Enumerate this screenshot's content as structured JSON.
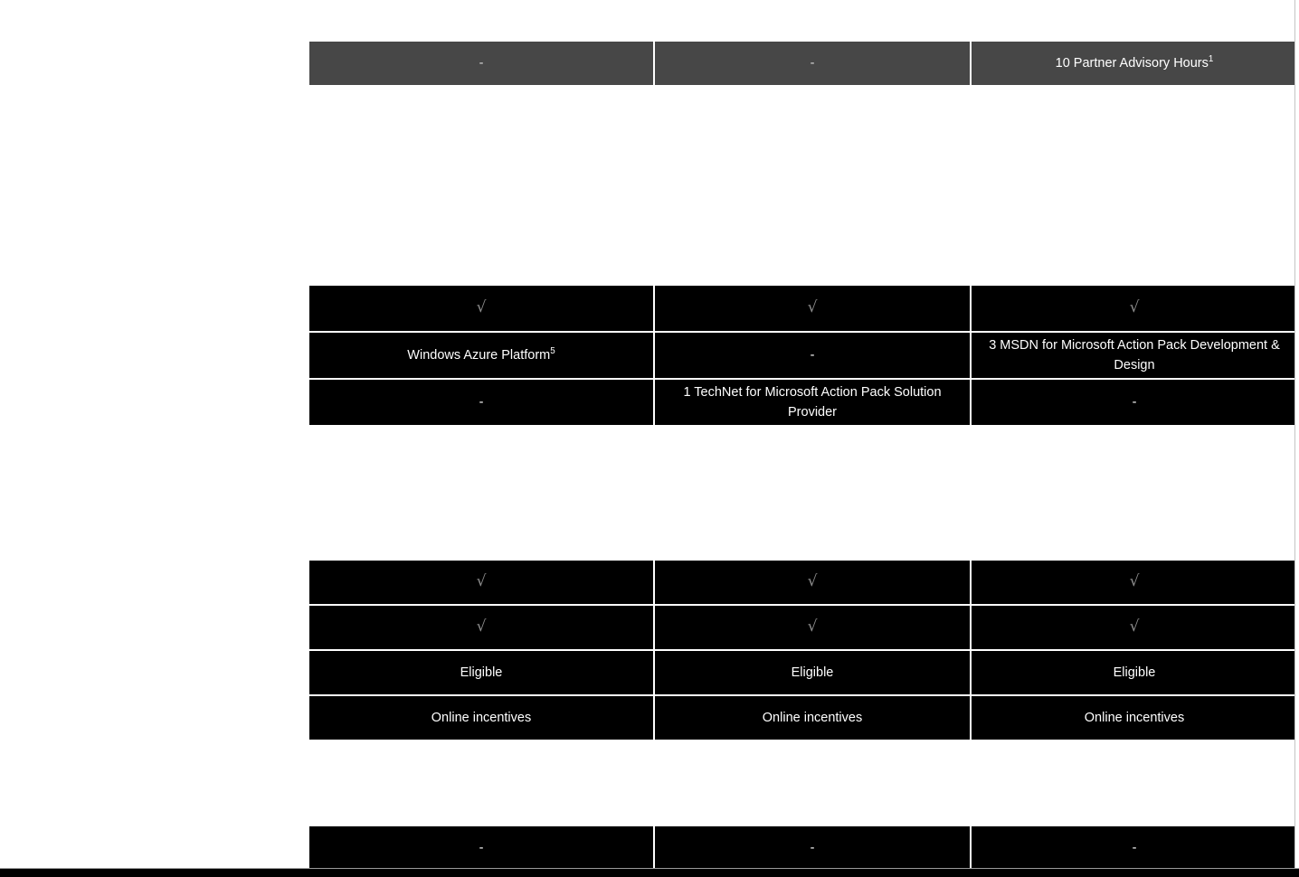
{
  "document": {
    "background_color": "#ffffff",
    "accent_dark": "#474747",
    "cell_background": "#000000",
    "cell_text_color": "#ffffff",
    "check_glyph_color": "#8d8d8d",
    "check_glyph": "√",
    "dash_glyph": "-"
  },
  "table_blocks": [
    {
      "id": "top-block",
      "style": "gray",
      "rows": [
        {
          "id": "row-partner-advisory-hours",
          "cells": [
            {
              "text": "-",
              "kind": "dash"
            },
            {
              "text": "-",
              "kind": "dash"
            },
            {
              "text": "10 Partner Advisory Hours",
              "sup": "1",
              "kind": "text"
            }
          ]
        }
      ]
    },
    {
      "id": "middle-block",
      "style": "black",
      "rows": [
        {
          "id": "row-check-1",
          "cells": [
            {
              "text": "√",
              "kind": "check"
            },
            {
              "text": "√",
              "kind": "check"
            },
            {
              "text": "√",
              "kind": "check"
            }
          ]
        },
        {
          "id": "row-azure-msdn",
          "cells": [
            {
              "text": "Windows Azure Platform",
              "sup": "5",
              "kind": "text"
            },
            {
              "text": "-",
              "kind": "dash"
            },
            {
              "text": "3 MSDN for Microsoft Action Pack Development  & Design",
              "kind": "text"
            }
          ]
        },
        {
          "id": "row-technet",
          "cells": [
            {
              "text": "-",
              "kind": "dash"
            },
            {
              "text": "1 TechNet for Microsoft Action Pack Solution Provider",
              "kind": "text"
            },
            {
              "text": "-",
              "kind": "dash"
            }
          ]
        }
      ]
    },
    {
      "id": "lower-block",
      "style": "black",
      "rows": [
        {
          "id": "row-check-2",
          "cells": [
            {
              "text": "√",
              "kind": "check"
            },
            {
              "text": "√",
              "kind": "check"
            },
            {
              "text": "√",
              "kind": "check"
            }
          ]
        },
        {
          "id": "row-check-3",
          "cells": [
            {
              "text": "√",
              "kind": "check"
            },
            {
              "text": "√",
              "kind": "check"
            },
            {
              "text": "√",
              "kind": "check"
            }
          ]
        },
        {
          "id": "row-eligible",
          "cells": [
            {
              "text": "Eligible",
              "kind": "text"
            },
            {
              "text": "Eligible",
              "kind": "text"
            },
            {
              "text": "Eligible",
              "kind": "text"
            }
          ]
        },
        {
          "id": "row-online-incentives",
          "cells": [
            {
              "text": "Online incentives",
              "kind": "text"
            },
            {
              "text": "Online incentives",
              "kind": "text"
            },
            {
              "text": "Online incentives",
              "kind": "text"
            }
          ]
        }
      ]
    },
    {
      "id": "bottom-block",
      "style": "black",
      "rows": [
        {
          "id": "row-dashes-bottom",
          "cells": [
            {
              "text": "-",
              "kind": "dash"
            },
            {
              "text": "-",
              "kind": "dash"
            },
            {
              "text": "-",
              "kind": "dash"
            }
          ]
        }
      ]
    }
  ],
  "scrollbar": {
    "name": "vertical-scrollbar",
    "track_color": "#ffffff",
    "border_color": "#c4c4c4"
  }
}
